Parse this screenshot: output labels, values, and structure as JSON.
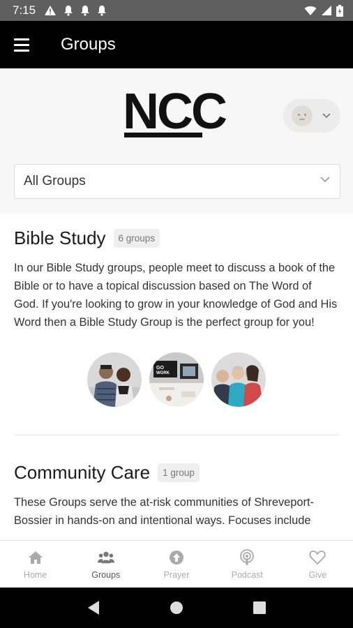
{
  "status_bar": {
    "time": "7:15",
    "left_icons": [
      "warning-icon",
      "bell-icon",
      "bell-icon",
      "bell-icon"
    ],
    "right_icons": [
      "wifi-icon",
      "signal-icon",
      "battery-icon"
    ]
  },
  "app_bar": {
    "title": "Groups",
    "menu_icon": "hamburger-menu-icon"
  },
  "header": {
    "logo_text": "NCC",
    "profile_icon": "profile-avatar-icon"
  },
  "filter": {
    "selected": "All Groups"
  },
  "sections": [
    {
      "title": "Bible Study",
      "count": "6 groups",
      "description": "In our Bible Study groups, people meet to discuss a book of the Bible or to have a topical discussion based on The Word of God. If you're looking to grow in your knowledge of God and His Word then a Bible Study Group is the perfect group for you!",
      "photos": [
        "couple-photo",
        "desk-photo",
        "group-photo"
      ]
    },
    {
      "title": "Community Care",
      "count": "1 group",
      "description": "These Groups serve the at-risk communities of Shreveport-Bossier in hands-on and intentional ways. Focuses include"
    }
  ],
  "bottom_nav": [
    {
      "label": "Home",
      "icon": "home-icon",
      "active": false
    },
    {
      "label": "Groups",
      "icon": "groups-icon",
      "active": true
    },
    {
      "label": "Prayer",
      "icon": "prayer-icon",
      "active": false
    },
    {
      "label": "Podcast",
      "icon": "podcast-icon",
      "active": false
    },
    {
      "label": "Give",
      "icon": "heart-icon",
      "active": false
    }
  ],
  "colors": {
    "app_bar": "#000000",
    "header_bg": "#f7f7f7",
    "nav_inactive": "#aaaaaa",
    "nav_active": "#555555"
  }
}
